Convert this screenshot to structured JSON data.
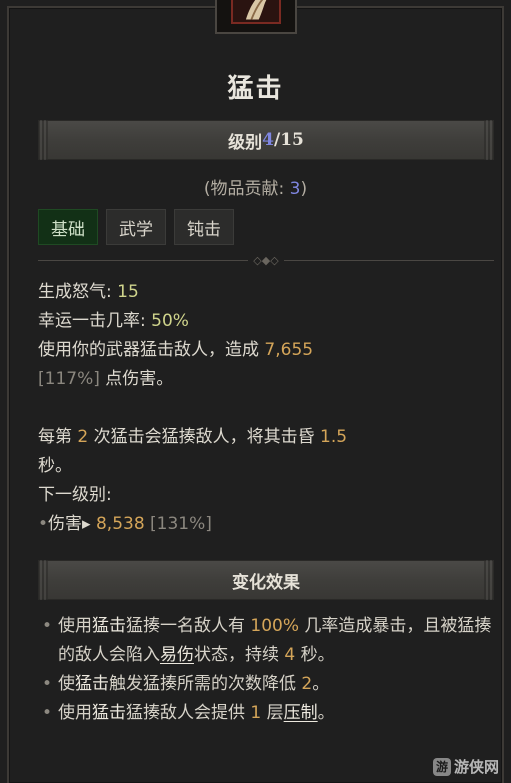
{
  "skill": {
    "name": "猛击",
    "icon": "slam-skill-icon"
  },
  "rank": {
    "label": "级别",
    "current": "4",
    "max": "/15"
  },
  "contribution": {
    "prefix": "(物品贡献: ",
    "value": "3",
    "suffix": ")"
  },
  "tags": [
    {
      "label": "基础",
      "active": true
    },
    {
      "label": "武学",
      "active": false
    },
    {
      "label": "钝击",
      "active": false
    }
  ],
  "stats": {
    "fury_label": "生成怒气: ",
    "fury_value": "15",
    "lucky_label": "幸运一击几率: ",
    "lucky_value": "50%"
  },
  "description": {
    "line1_prefix": "使用你的武器猛击敌人，造成 ",
    "damage": "7,655",
    "line2_percent": "[117%]",
    "line2_suffix": " 点伤害。",
    "line3_prefix": "每第 ",
    "every_n": "2",
    "line3_mid": " 次猛击会猛揍敌人，将其击昏 ",
    "stun_seconds": "1.5",
    "line4": "秒。"
  },
  "next_rank": {
    "label": "下一级别:",
    "bullet": "•",
    "stat_label": "伤害",
    "arrow": "▸ ",
    "value": "8,538",
    "percent": " [131%]"
  },
  "upgrades": {
    "header": "变化效果",
    "items": [
      {
        "p1": "使用",
        "kw": "猛击",
        "p2": "猛揍一名敌人有 ",
        "n1": "100%",
        "p3": " 几率造成暴击，且被猛揍的敌人会陷入",
        "link": "易伤",
        "p4": "状态，持续 ",
        "n2": "4",
        "p5": " 秒。"
      },
      {
        "p1": "使",
        "kw": "猛击",
        "p2": "触发猛揍所需的次数降低 ",
        "n1": "2",
        "p3": "。"
      },
      {
        "p1": "使用",
        "kw": "猛击",
        "p2": "猛揍敌人会提供 ",
        "n1": "1",
        "p3": " 层",
        "link": "压制",
        "p4": "。"
      }
    ]
  },
  "watermark": {
    "logo": "游",
    "text": "游侠网"
  },
  "colors": {
    "accent_blue": "#7f86e0",
    "value_green": "#cfd48c",
    "value_orange": "#d4a559",
    "tag_active_bg": "#123016"
  }
}
